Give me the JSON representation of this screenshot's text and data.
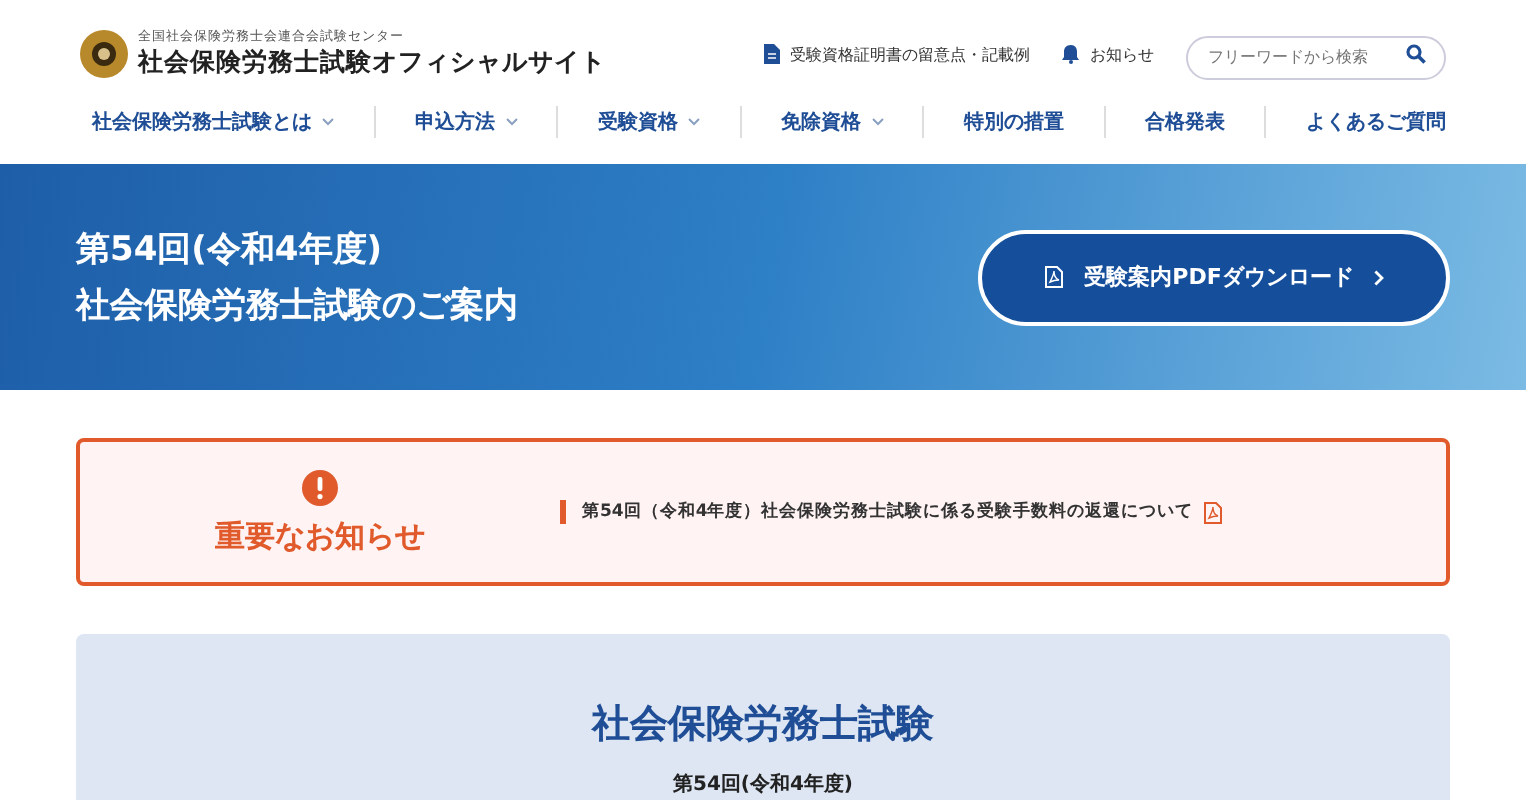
{
  "header": {
    "org": "全国社会保険労務士会連合会試験センター",
    "site_title": "社会保険労務士試験オフィシャルサイト",
    "links": [
      {
        "label": "受験資格証明書の留意点・記載例",
        "kind": "document"
      },
      {
        "label": "お知らせ",
        "kind": "bell"
      }
    ],
    "search": {
      "placeholder": "フリーワードから検索"
    }
  },
  "nav": [
    {
      "label": "社会保険労務士試験とは",
      "has_menu": true
    },
    {
      "label": "申込方法",
      "has_menu": true
    },
    {
      "label": "受験資格",
      "has_menu": true
    },
    {
      "label": "免除資格",
      "has_menu": true
    },
    {
      "label": "特別の措置",
      "has_menu": false
    },
    {
      "label": "合格発表",
      "has_menu": false
    },
    {
      "label": "よくあるご質問",
      "has_menu": false
    }
  ],
  "hero": {
    "title_lines": [
      "第54回(令和4年度)",
      "社会保険労務士試験のご案内"
    ],
    "button": "受験案内PDFダウンロード"
  },
  "notice": {
    "heading": "重要なお知らせ",
    "items": [
      {
        "text": "第54回（令和4年度）社会保険労務士試験に係る受験手数料の返還について",
        "pdf": true
      }
    ]
  },
  "intro": {
    "title": "社会保険労務士試験",
    "subtitle": "第54回(令和4年度)"
  }
}
